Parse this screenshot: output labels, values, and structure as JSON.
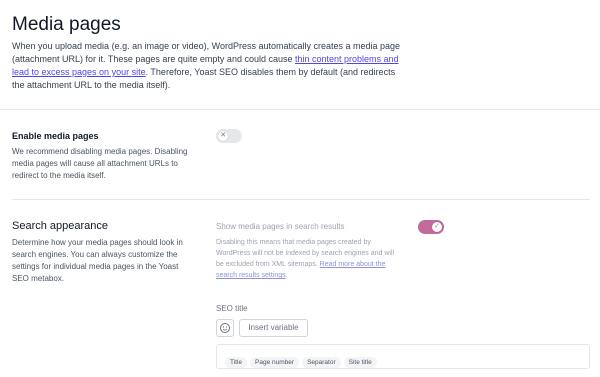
{
  "page": {
    "title": "Media pages",
    "intro_part1": "When you upload media (e.g. an image or video), WordPress automatically creates a media page (attachment URL) for it. These pages are quite empty and could cause ",
    "intro_link": "thin content problems and lead to excess pages on your site",
    "intro_part2": ". Therefore, Yoast SEO disables them by default (and redirects the attachment URL to the media itself)."
  },
  "enable_section": {
    "heading": "Enable media pages",
    "description": "We recommend disabling media pages. Disabling media pages will cause all attachment URLs to redirect to the media itself.",
    "toggle_icon": "x-icon",
    "toggle_on": false
  },
  "search_section": {
    "heading": "Search appearance",
    "description": "Determine how your media pages should look in search engines. You can always customize the settings for individual media pages in the Yoast SEO metabox.",
    "show_label": "Show media pages in search results",
    "show_help": "Disabling this means that media pages created by WordPress will not be indexed by search engines and will be excluded from XML sitemaps.",
    "show_help_link": "Read more about the search results settings",
    "show_help_after_link": ".",
    "toggle_icon": "check-icon",
    "toggle_on": true,
    "seo_title_label": "SEO title",
    "emoji_icon": "smiley-icon",
    "insert_variable_label": "Insert variable",
    "variables": [
      "Title",
      "Page number",
      "Separator",
      "Site title"
    ]
  },
  "colors": {
    "accent": "#c26a9b",
    "link": "#4f46e5"
  }
}
